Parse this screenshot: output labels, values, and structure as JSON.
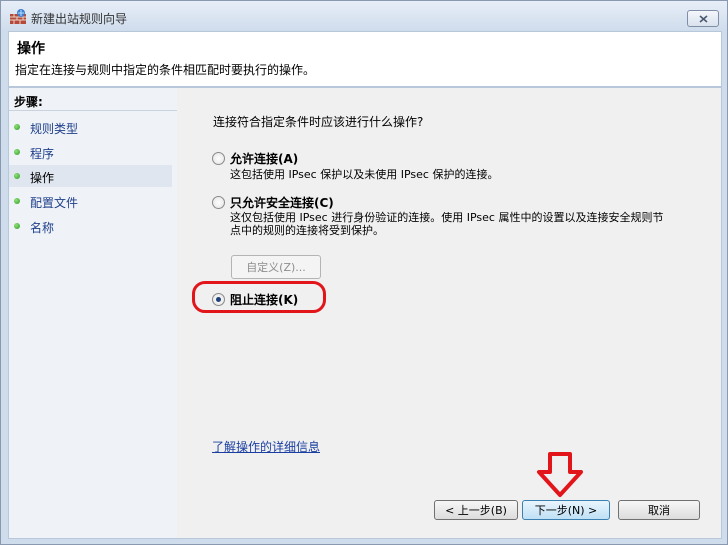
{
  "window": {
    "title": "新建出站规则向导"
  },
  "header": {
    "title": "操作",
    "description": "指定在连接与规则中指定的条件相匹配时要执行的操作。"
  },
  "sidebar": {
    "steps_label": "步骤:",
    "steps": [
      {
        "label": "规则类型"
      },
      {
        "label": "程序"
      },
      {
        "label": "操作"
      },
      {
        "label": "配置文件"
      },
      {
        "label": "名称"
      }
    ]
  },
  "content": {
    "question": "连接符合指定条件时应该进行什么操作?",
    "options": [
      {
        "label": "允许连接(A)",
        "desc": "这包括使用 IPsec 保护以及未使用 IPsec 保护的连接。",
        "checked": false
      },
      {
        "label": "只允许安全连接(C)",
        "desc": "这仅包括使用 IPsec 进行身份验证的连接。使用 IPsec 属性中的设置以及连接安全规则节点中的规则的连接将受到保护。",
        "checked": false
      },
      {
        "label": "阻止连接(K)",
        "desc": "",
        "checked": true
      }
    ],
    "customize_label": "自定义(Z)...",
    "learn_more": "了解操作的详细信息"
  },
  "buttons": {
    "back": "< 上一步(B)",
    "next": "下一步(N) >",
    "cancel": "取消"
  },
  "colors": {
    "highlight": "#e1151a",
    "link": "#1a3fa0"
  }
}
